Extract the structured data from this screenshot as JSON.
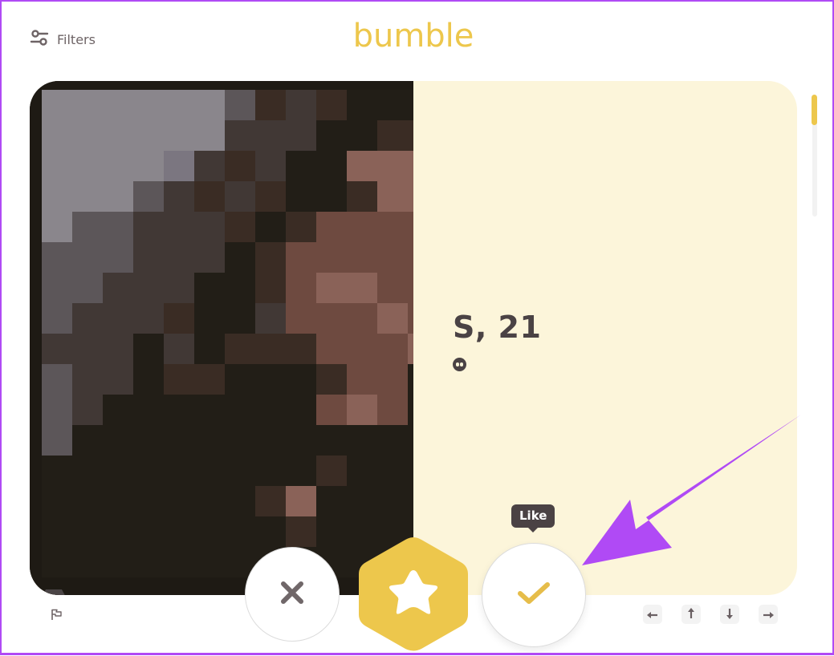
{
  "header": {
    "filters_label": "Filters",
    "filters_icon": "sliders-icon",
    "logo_text": "bumble"
  },
  "profile": {
    "name_age": "S, 21",
    "quote_icon": "quote-icon",
    "photo_state": "pixelated",
    "badge_icon": "bumble-hive-icon"
  },
  "actions": {
    "pass_icon": "close-icon",
    "superswipe_icon": "star-icon",
    "like_icon": "check-icon",
    "tooltip": "Like"
  },
  "footer": {
    "report_icon": "flag-icon",
    "keys": [
      {
        "icon": "arrow-left-icon",
        "glyph": "←"
      },
      {
        "icon": "arrow-up-icon",
        "glyph": "↑"
      },
      {
        "icon": "arrow-down-icon",
        "glyph": "↓"
      },
      {
        "icon": "arrow-right-icon",
        "glyph": "→"
      }
    ]
  },
  "scrollbar": {
    "position": 0
  },
  "colors": {
    "brand": "#edc74c",
    "card_bg": "#fcf5da",
    "text_dark": "#4a4244",
    "annotation": "#b04af5"
  }
}
